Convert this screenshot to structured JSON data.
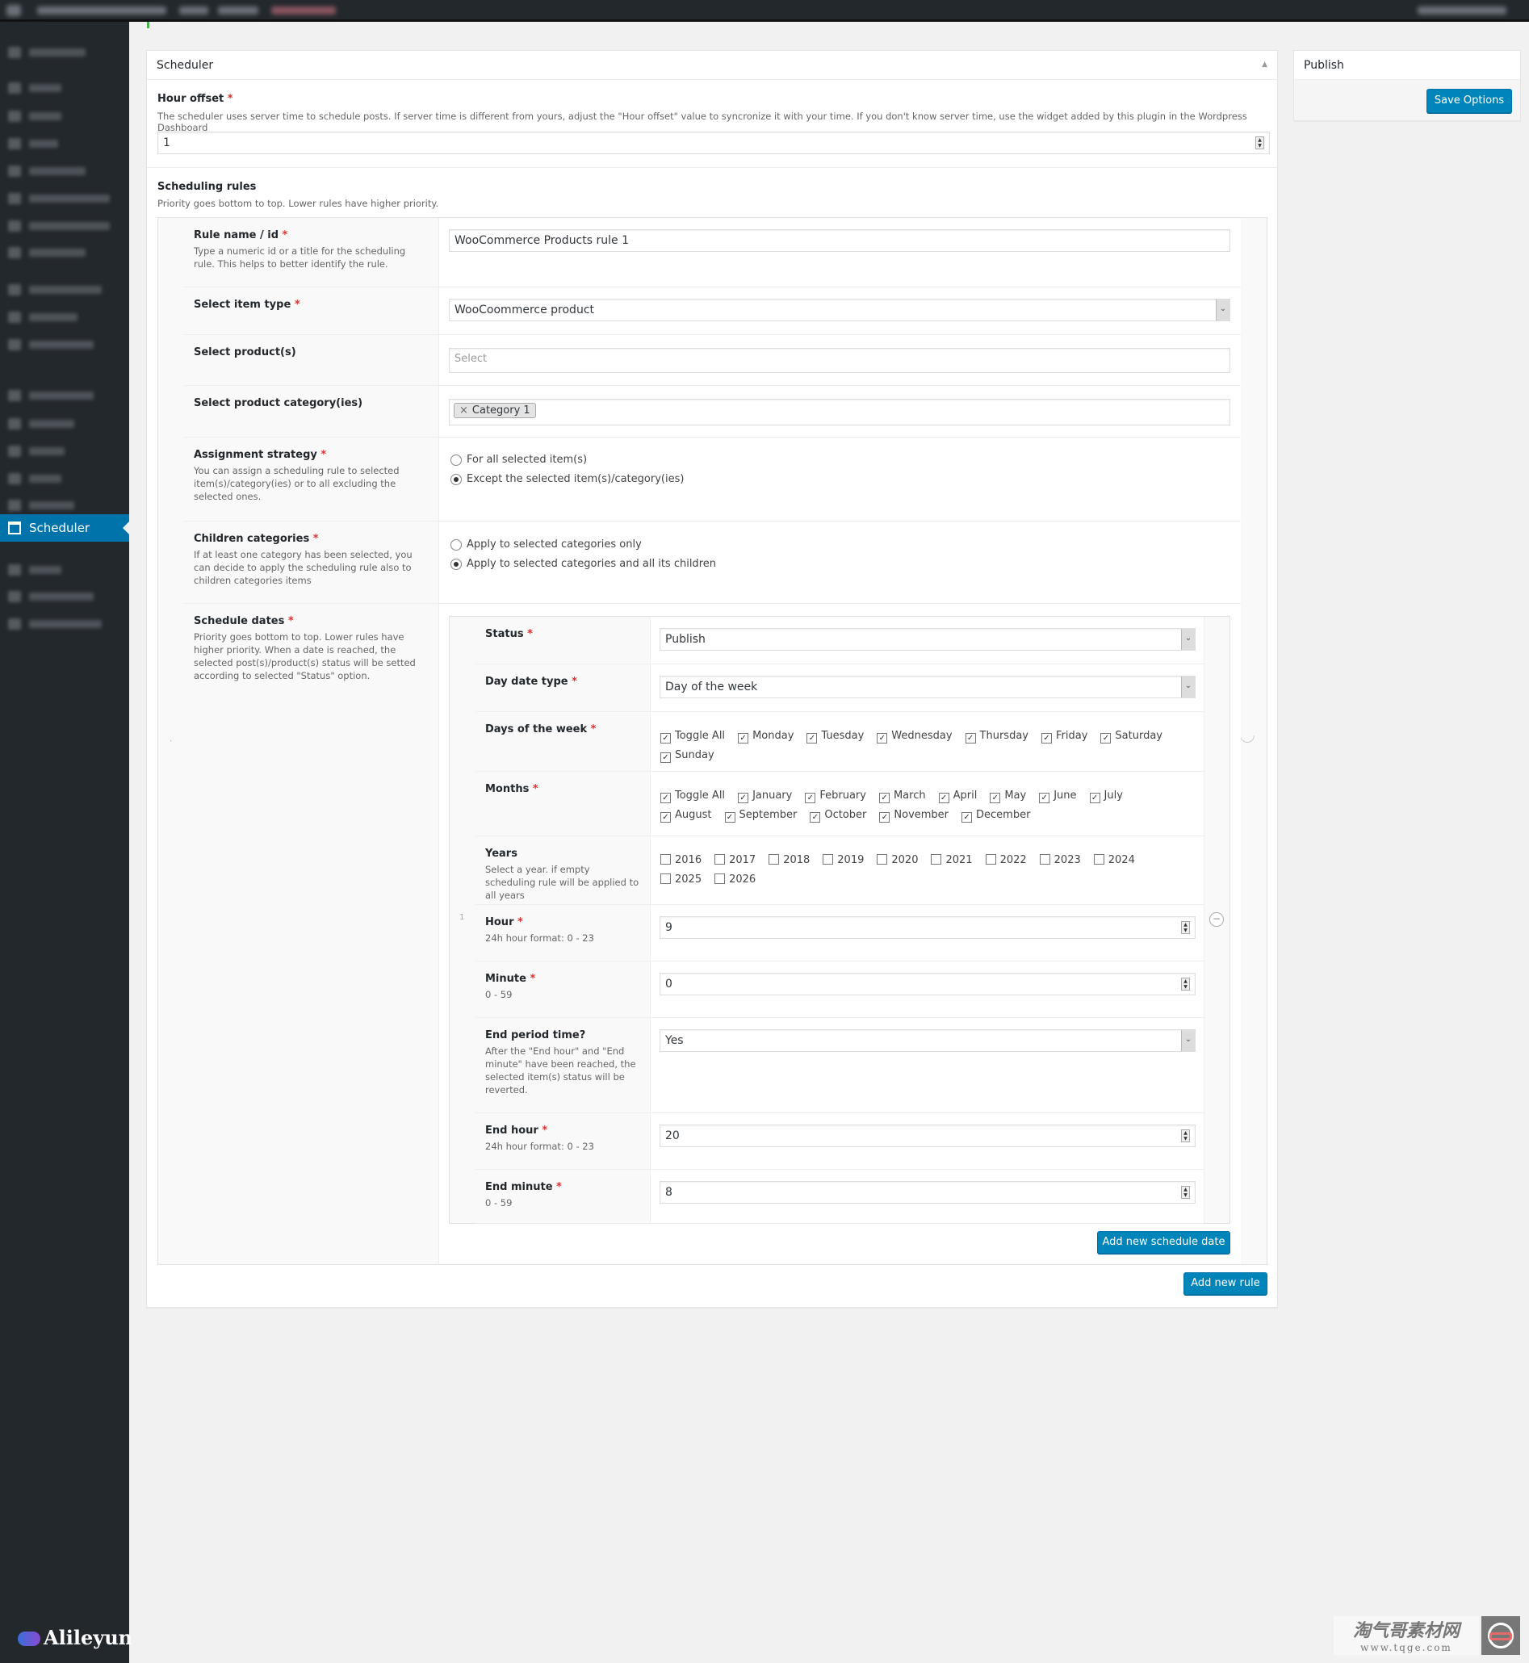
{
  "sidebar": {
    "active_label": "Scheduler"
  },
  "scheduler": {
    "title": "Scheduler",
    "hour_offset": {
      "label": "Hour offset",
      "desc": "The scheduler uses server time to schedule posts. If server time is different from yours, adjust the \"Hour offset\" value to syncronize it with your time. If you don't know server time, use the widget added by this plugin in the Wordpress Dashboard",
      "value": "1"
    },
    "rules": {
      "title": "Scheduling rules",
      "desc": "Priority goes bottom to top. Lower rules have higher priority."
    },
    "rule": {
      "name": {
        "label": "Rule name / id",
        "desc": "Type a numeric id or a title for the scheduling rule. This helps to better identify the rule.",
        "value": "WooCommerce Products rule 1"
      },
      "item_type": {
        "label": "Select item type",
        "value": "WooCoommerce product"
      },
      "products": {
        "label": "Select product(s)",
        "placeholder": "Select"
      },
      "categories": {
        "label": "Select product category(ies)",
        "tags": [
          "Category 1"
        ]
      },
      "assignment": {
        "label": "Assignment strategy",
        "desc": "You can assign a scheduling rule to selected item(s)/category(ies) or to all excluding the selected ones.",
        "options": [
          {
            "label": "For all selected item(s)",
            "checked": false
          },
          {
            "label": "Except the selected item(s)/category(ies)",
            "checked": true
          }
        ]
      },
      "children": {
        "label": "Children categories",
        "desc": "If at least one category has been selected, you can decide to apply the scheduling rule also to children categories items",
        "options": [
          {
            "label": "Apply to selected categories only",
            "checked": false
          },
          {
            "label": "Apply to selected categories and all its children",
            "checked": true
          }
        ]
      },
      "schedule_dates": {
        "label": "Schedule dates",
        "desc": "Priority goes bottom to top. Lower rules have higher priority. When a date is reached, the selected post(s)/product(s) status will be setted according to selected \"Status\" option.",
        "index": "1"
      }
    },
    "date": {
      "status": {
        "label": "Status",
        "value": "Publish"
      },
      "day_date_type": {
        "label": "Day date type",
        "value": "Day of the week"
      },
      "days": {
        "label": "Days of the week",
        "items": [
          {
            "label": "Toggle All",
            "checked": true
          },
          {
            "label": "Monday",
            "checked": true
          },
          {
            "label": "Tuesday",
            "checked": true
          },
          {
            "label": "Wednesday",
            "checked": true
          },
          {
            "label": "Thursday",
            "checked": true
          },
          {
            "label": "Friday",
            "checked": true
          },
          {
            "label": "Saturday",
            "checked": true
          },
          {
            "label": "Sunday",
            "checked": true
          }
        ]
      },
      "months": {
        "label": "Months",
        "items": [
          {
            "label": "Toggle All",
            "checked": true
          },
          {
            "label": "January",
            "checked": true
          },
          {
            "label": "February",
            "checked": true
          },
          {
            "label": "March",
            "checked": true
          },
          {
            "label": "April",
            "checked": true
          },
          {
            "label": "May",
            "checked": true
          },
          {
            "label": "June",
            "checked": true
          },
          {
            "label": "July",
            "checked": true
          },
          {
            "label": "August",
            "checked": true
          },
          {
            "label": "September",
            "checked": true
          },
          {
            "label": "October",
            "checked": true
          },
          {
            "label": "November",
            "checked": true
          },
          {
            "label": "December",
            "checked": true
          }
        ]
      },
      "years": {
        "label": "Years",
        "desc": "Select a year. if empty scheduling rule will be applied to all years",
        "items": [
          {
            "label": "2016",
            "checked": false
          },
          {
            "label": "2017",
            "checked": false
          },
          {
            "label": "2018",
            "checked": false
          },
          {
            "label": "2019",
            "checked": false
          },
          {
            "label": "2020",
            "checked": false
          },
          {
            "label": "2021",
            "checked": false
          },
          {
            "label": "2022",
            "checked": false
          },
          {
            "label": "2023",
            "checked": false
          },
          {
            "label": "2024",
            "checked": false
          },
          {
            "label": "2025",
            "checked": false
          },
          {
            "label": "2026",
            "checked": false
          }
        ]
      },
      "hour": {
        "label": "Hour",
        "desc": "24h hour format: 0 - 23",
        "value": "9"
      },
      "minute": {
        "label": "Minute",
        "desc": "0 - 59",
        "value": "0"
      },
      "end_period": {
        "label": "End period time?",
        "desc": "After the \"End hour\" and \"End minute\" have been reached, the selected item(s) status will be reverted.",
        "value": "Yes"
      },
      "end_hour": {
        "label": "End hour",
        "desc": "24h hour format: 0 - 23",
        "value": "20"
      },
      "end_minute": {
        "label": "End minute",
        "desc": "0 - 59",
        "value": "8"
      }
    },
    "add_date_label": "Add new schedule date",
    "add_rule_label": "Add new rule"
  },
  "publish": {
    "title": "Publish",
    "save_label": "Save Options"
  },
  "watermarks": {
    "left": "Alileyun",
    "right_cn": "淘气哥素材网",
    "right_url": "www.tqge.com"
  },
  "colors": {
    "accent": "#0085ba",
    "sidebar": "#23282d",
    "required": "#dc3232"
  }
}
